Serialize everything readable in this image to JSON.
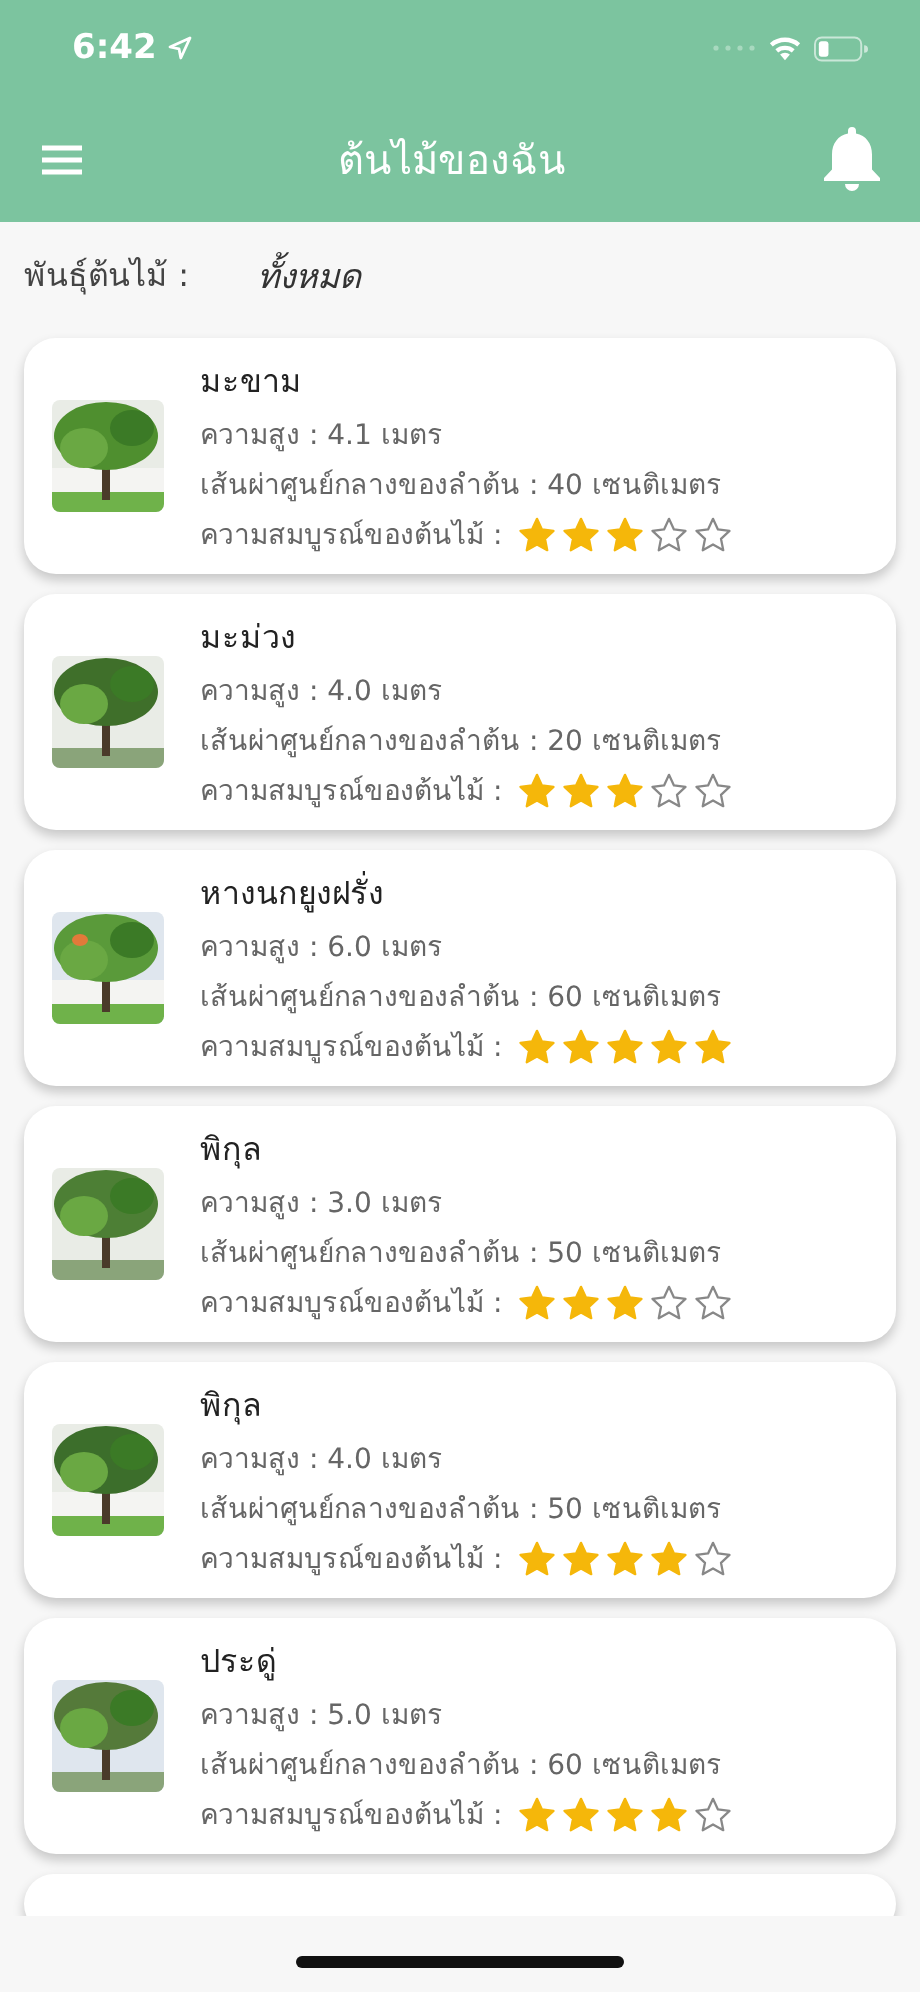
{
  "status_bar": {
    "time": "6:42"
  },
  "header": {
    "title": "ต้นไม้ของฉัน"
  },
  "filter": {
    "label": "พันธุ์ต้นไม้ :",
    "value": "ทั้งหมด"
  },
  "trees": [
    {
      "kind": "full",
      "name": "มะขาม",
      "height": "ความสูง : 4.1 เมตร",
      "diameter": "เส้นผ่าศูนย์กลางของลำต้น : 40 เซนติเมตร",
      "health_label": "ความสมบูรณ์ของต้นไม้ :",
      "stars": 3
    },
    {
      "kind": "full",
      "name": "มะม่วง",
      "height": "ความสูง : 4.0 เมตร",
      "diameter": "เส้นผ่าศูนย์กลางของลำต้น : 20 เซนติเมตร",
      "health_label": "ความสมบูรณ์ของต้นไม้ :",
      "stars": 3
    },
    {
      "kind": "full",
      "name": "หางนกยูงฝรั่ง",
      "height": "ความสูง : 6.0 เมตร",
      "diameter": "เส้นผ่าศูนย์กลางของลำต้น : 60 เซนติเมตร",
      "health_label": "ความสมบูรณ์ของต้นไม้ :",
      "stars": 5
    },
    {
      "kind": "full",
      "name": "พิกุล",
      "height": "ความสูง : 3.0 เมตร",
      "diameter": "เส้นผ่าศูนย์กลางของลำต้น : 50 เซนติเมตร",
      "health_label": "ความสมบูรณ์ของต้นไม้ :",
      "stars": 3
    },
    {
      "kind": "full",
      "name": "พิกุล",
      "height": "ความสูง : 4.0 เมตร",
      "diameter": "เส้นผ่าศูนย์กลางของลำต้น : 50 เซนติเมตร",
      "health_label": "ความสมบูรณ์ของต้นไม้ :",
      "stars": 4
    },
    {
      "kind": "full",
      "name": "ประดู่",
      "height": "ความสูง : 5.0 เมตร",
      "diameter": "เส้นผ่าศูนย์กลางของลำต้น : 60 เซนติเมตร",
      "health_label": "ความสมบูรณ์ของต้นไม้ :",
      "stars": 4
    },
    {
      "kind": "cut"
    }
  ]
}
